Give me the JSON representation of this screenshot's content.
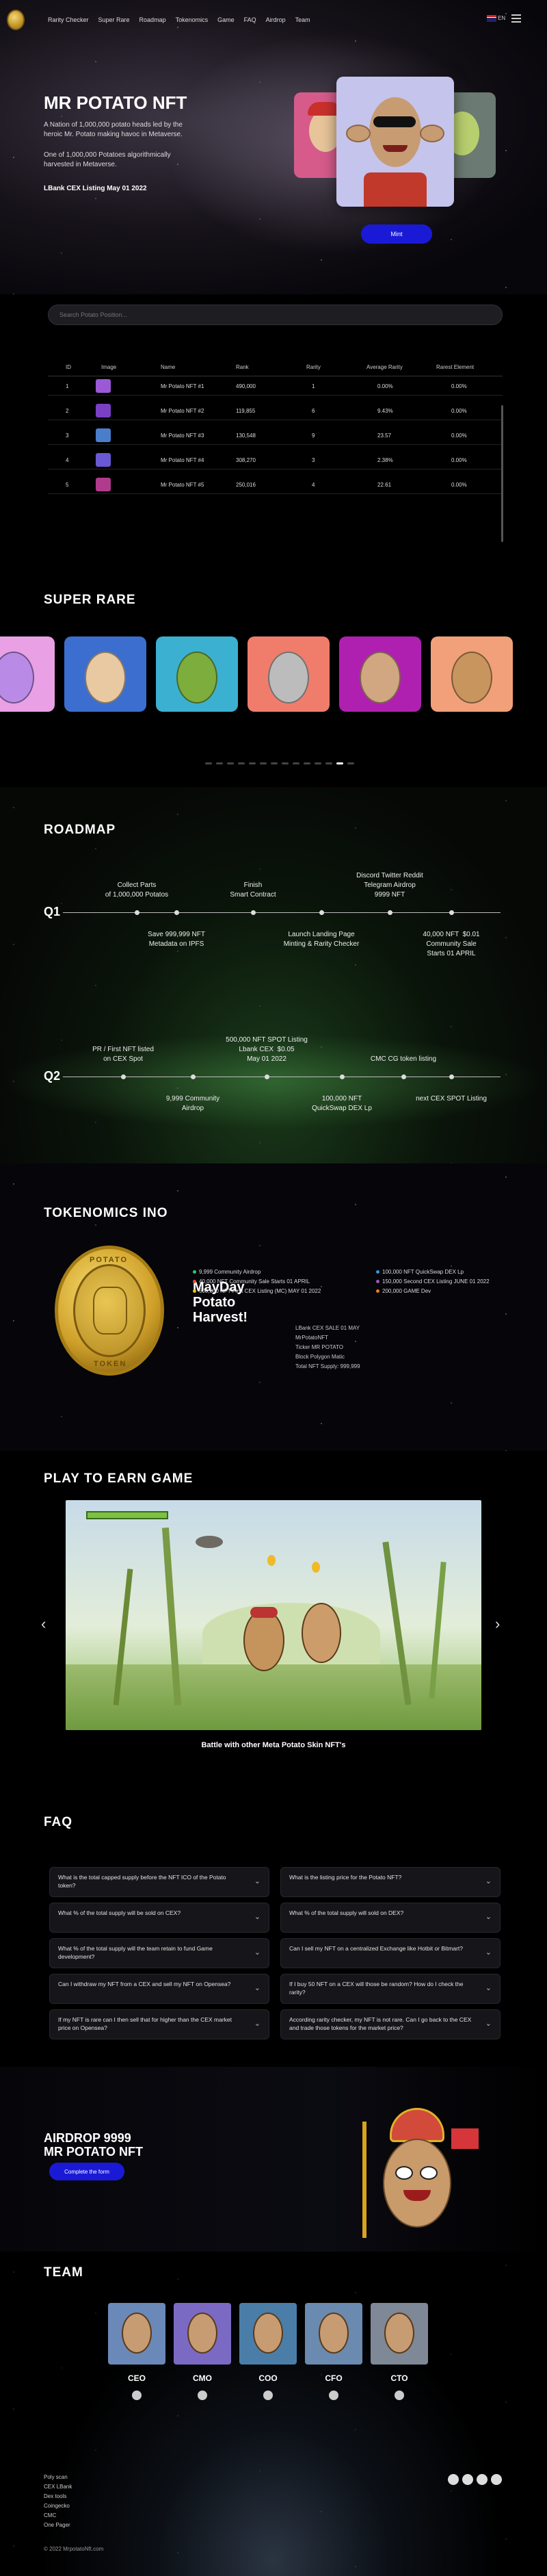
{
  "nav": {
    "items": [
      "Rarity Checker",
      "Super Rare",
      "Roadmap",
      "Tokenomics",
      "Game",
      "FAQ",
      "Airdrop",
      "Team"
    ],
    "lang": "EN"
  },
  "hero": {
    "title": "MR POTATO NFT",
    "p1": "A Nation of 1,000,000 potato heads led by the heroic Mr. Potato making havoc in Metaverse.",
    "p2": "One of 1,000,000 Potatoes algorithmically harvested in Metaverse.",
    "p3": "LBank CEX Listing May 01 2022",
    "mint": "Mint"
  },
  "table": {
    "search_placeholder": "Search Potato Position...",
    "headers": [
      "ID",
      "Image",
      "Name",
      "Rank",
      "Rarity",
      "Average Rarity",
      "Rarest Element"
    ],
    "rows": [
      {
        "id": "1",
        "name": "Mr Potato NFT #1",
        "rank": "490,000",
        "rarity": "1",
        "avg": "0.00%",
        "rare": "0.00%",
        "color": "#9b59d6"
      },
      {
        "id": "2",
        "name": "Mr Potato NFT #2",
        "rank": "119,855",
        "rarity": "6",
        "avg": "9.43%",
        "rare": "0.00%",
        "color": "#7b3fc4"
      },
      {
        "id": "3",
        "name": "Mr Potato NFT #3",
        "rank": "130,548",
        "rarity": "9",
        "avg": "23.57",
        "rare": "0.00%",
        "color": "#4a7ecb"
      },
      {
        "id": "4",
        "name": "Mr Potato NFT #4",
        "rank": "308,270",
        "rarity": "3",
        "avg": "2.38%",
        "rare": "0.00%",
        "color": "#6a58d4"
      },
      {
        "id": "5",
        "name": "Mr Potato NFT #5",
        "rank": "250,016",
        "rarity": "4",
        "avg": "22.61",
        "rare": "0.00%",
        "color": "#b03a8c"
      }
    ]
  },
  "rare": {
    "title": "SUPER RARE",
    "tiles": [
      {
        "bg": "#e9a0e4",
        "skin": "#b98be6"
      },
      {
        "bg": "#3c6ed0",
        "skin": "#e8c9a2"
      },
      {
        "bg": "#3bb0d1",
        "skin": "#7dad3c"
      },
      {
        "bg": "#f07d6b",
        "skin": "#bcbcbc"
      },
      {
        "bg": "#b020b0",
        "skin": "#d0a780"
      },
      {
        "bg": "#f2a07a",
        "skin": "#c8955e"
      }
    ]
  },
  "roadmap": {
    "title": "ROADMAP",
    "q1": "Q1",
    "q2": "Q2",
    "q1_top": [
      "Collect Parts\nof 1,000,000 Potatos",
      "Finish\nSmart Contract",
      "Discord Twitter Reddit\nTelegram Airdrop\n9999 NFT"
    ],
    "q1_bottom": [
      "Save 999,999 NFT\nMetadata on IPFS",
      "Launch Landing Page\nMinting & Rarity Checker",
      "40,000 NFT  $0.01\nCommunity Sale\nStarts 01 APRIL"
    ],
    "q2_top": [
      "PR / First NFT listed\non CEX Spot",
      "500,000 NFT SPOT Listing\nLbank CEX  $0.05\nMay 01 2022",
      "CMC CG token listing"
    ],
    "q2_bottom": [
      "9,999 Community\nAirdrop",
      "100,000 NFT\nQuickSwap DEX Lp",
      "next CEX SPOT Listing"
    ]
  },
  "tokenomics": {
    "title": "TOKENOMICS INO",
    "coin_top": "POTATO",
    "coin_bottom": "TOKEN",
    "headline": "MayDay\nPotato\nHarvest!",
    "legend": [
      {
        "text": "9,999 Community Airdrop",
        "color": "#2ecc71"
      },
      {
        "text": "40,000 NFT Community Sale Starts 01 APRIL",
        "color": "#e74c3c"
      },
      {
        "text": "500,000 NFT First CEX Listing (MC) MAY 01 2022",
        "color": "#f1c40f"
      },
      {
        "text": "100,000 NFT QuickSwap DEX Lp",
        "color": "#3498db"
      },
      {
        "text": "150,000 Second CEX Listing JUNE 01 2022",
        "color": "#9b59b6"
      },
      {
        "text": "200,000 GAME Dev",
        "color": "#e67e22"
      }
    ],
    "info": [
      "LBank CEX SALE 01 MAY",
      "MrPotatoNFT",
      "Ticker MR POTATO",
      "Block Polygon Matic",
      "Total NFT Supply: 999,999"
    ]
  },
  "game": {
    "title": "PLAY TO EARN GAME",
    "caption": "Battle with other Meta Potato Skin NFT's",
    "prev": "‹",
    "next": "›"
  },
  "faq": {
    "title": "FAQ",
    "items": [
      "What is the total capped supply before the NFT ICO of the Potato token?",
      "What is the listing price for the Potato NFT?",
      "What % of the total supply will be sold on CEX?",
      "What % of the total supply will sold on DEX?",
      "What % of the total supply will the team retain to fund Game development?",
      "Can I sell my NFT on a centralized Exchange like Hotbit or Bitmart?",
      "Can I withdraw my NFT from a CEX and sell my NFT on Opensea?",
      "If I buy 50 NFT on a CEX will those be random? How do I check the rarity?",
      "If my NFT is rare can I then sell that for higher than the CEX market price on Opensea?",
      "According rarity checker, my NFT is not rare. Can I go back to the CEX and trade those tokens for the market price?"
    ],
    "chevron": "⌄"
  },
  "airdrop": {
    "title": "AIRDROP 9999\nMR POTATO NFT",
    "button": "Complete the form"
  },
  "team": {
    "title": "TEAM",
    "members": [
      {
        "role": "CEO",
        "bg": "#6a89b8"
      },
      {
        "role": "CMO",
        "bg": "#7b6ac4"
      },
      {
        "role": "COO",
        "bg": "#4a7ea8"
      },
      {
        "role": "CFO",
        "bg": "#6a8ab0"
      },
      {
        "role": "CTO",
        "bg": "#7e8896"
      }
    ]
  },
  "footer": {
    "links": [
      "Poly scan",
      "CEX LBank",
      "Dex tools",
      "Coingecko",
      "CMC",
      "One Pager"
    ],
    "copyright": "© 2022 MrpotatoNft.com"
  }
}
